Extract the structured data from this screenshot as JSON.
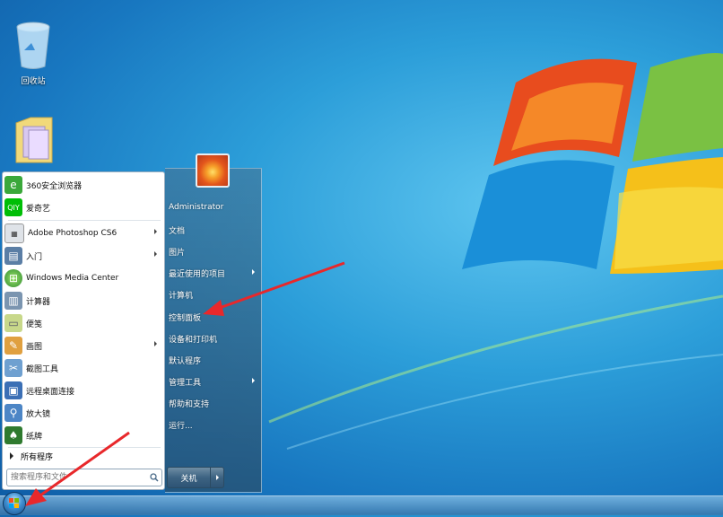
{
  "desktop": {
    "icons": [
      {
        "label": "回收站",
        "icon": "recycle-bin-icon"
      },
      {
        "label": "",
        "icon": "folder-icon"
      }
    ]
  },
  "start_menu": {
    "programs": [
      {
        "label": "360安全浏览器",
        "icon": "360-browser-icon",
        "color": "#3aa83a",
        "submenu": false
      },
      {
        "label": "爱奇艺",
        "icon": "iqiyi-icon",
        "color": "#00be06",
        "submenu": false
      },
      {
        "label": "Adobe Photoshop CS6",
        "icon": "photoshop-icon",
        "color": "#8a8a8a",
        "submenu": true
      },
      {
        "label": "入门",
        "icon": "getting-started-icon",
        "color": "#5b7ea5",
        "submenu": true
      },
      {
        "label": "Windows Media Center",
        "icon": "media-center-icon",
        "color": "#3f9a3f",
        "submenu": false
      },
      {
        "label": "计算器",
        "icon": "calculator-icon",
        "color": "#7b95b0",
        "submenu": false
      },
      {
        "label": "便笺",
        "icon": "sticky-notes-icon",
        "color": "#c8d88a",
        "submenu": false
      },
      {
        "label": "画图",
        "icon": "paint-icon",
        "color": "#e0a040",
        "submenu": true
      },
      {
        "label": "截图工具",
        "icon": "snipping-tool-icon",
        "color": "#6fa0d0",
        "submenu": false
      },
      {
        "label": "远程桌面连接",
        "icon": "remote-desktop-icon",
        "color": "#3b6fb5",
        "submenu": false
      },
      {
        "label": "放大镜",
        "icon": "magnifier-icon",
        "color": "#4d86c6",
        "submenu": false
      },
      {
        "label": "纸牌",
        "icon": "solitaire-icon",
        "color": "#2f7a2f",
        "submenu": false
      }
    ],
    "all_programs": "所有程序",
    "search": {
      "placeholder": "搜索程序和文件"
    },
    "user": "Administrator",
    "places": [
      {
        "label": "文档",
        "submenu": false
      },
      {
        "label": "图片",
        "submenu": false
      },
      {
        "label": "最近使用的项目",
        "submenu": true
      },
      {
        "label": "计算机",
        "submenu": false
      },
      {
        "label": "控制面板",
        "submenu": false
      },
      {
        "label": "设备和打印机",
        "submenu": false
      },
      {
        "label": "默认程序",
        "submenu": false
      },
      {
        "label": "管理工具",
        "submenu": true
      },
      {
        "label": "帮助和支持",
        "submenu": false
      },
      {
        "label": "运行...",
        "submenu": false
      }
    ],
    "shutdown_label": "关机"
  },
  "colors": {
    "annotation_arrow": "#e8282b",
    "accent": "#1877c0"
  }
}
